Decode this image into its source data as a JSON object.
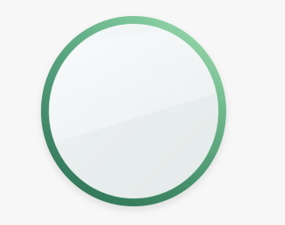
{
  "icon": {
    "name": "glass-orb-icon",
    "colors": {
      "background": "#f7f7f7",
      "ring_dark": "#2e7a5a",
      "ring_mid": "#5bb087",
      "ring_light": "#93dba8",
      "glass_top": "#f6f9fb",
      "glass_bottom": "#e7eceb"
    }
  }
}
